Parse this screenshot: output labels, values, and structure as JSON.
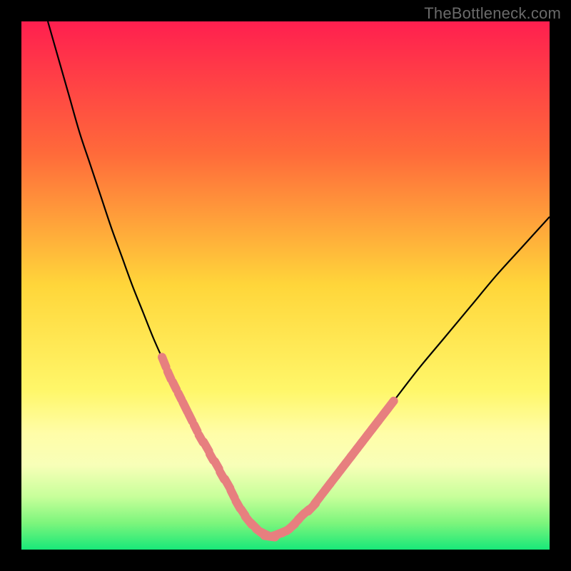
{
  "watermark": "TheBottleneck.com",
  "colors": {
    "frame": "#000000",
    "curve": "#000000",
    "overlay": "#e77f7f",
    "watermark": "#6a6a6a"
  },
  "chart_data": {
    "type": "line",
    "title": "",
    "xlabel": "",
    "ylabel": "",
    "xlim": [
      0,
      100
    ],
    "ylim": [
      0,
      100
    ],
    "background_gradient": [
      {
        "pos": 0.0,
        "color": "#ff1f4f"
      },
      {
        "pos": 0.25,
        "color": "#ff6a3a"
      },
      {
        "pos": 0.5,
        "color": "#ffd63a"
      },
      {
        "pos": 0.7,
        "color": "#fff76a"
      },
      {
        "pos": 0.78,
        "color": "#fffda8"
      },
      {
        "pos": 0.84,
        "color": "#f8ffb8"
      },
      {
        "pos": 0.9,
        "color": "#c7ff9a"
      },
      {
        "pos": 0.95,
        "color": "#7cf57c"
      },
      {
        "pos": 1.0,
        "color": "#18e879"
      }
    ],
    "series": [
      {
        "name": "bottleneck-curve",
        "x": [
          5,
          7,
          9,
          11,
          13,
          15,
          17,
          19,
          21,
          23,
          25,
          27,
          29,
          31,
          33,
          35,
          37,
          39,
          40,
          41,
          43,
          45,
          47,
          50,
          55,
          60,
          65,
          70,
          75,
          80,
          85,
          90,
          95,
          100
        ],
        "y": [
          100,
          93,
          86,
          79,
          73,
          67,
          61,
          55.5,
          50,
          45,
          40,
          35.5,
          31,
          27,
          23,
          19.5,
          16,
          12.5,
          10.5,
          8.5,
          5.5,
          3.5,
          2.5,
          3.5,
          8,
          14.5,
          21,
          27.5,
          34,
          40,
          46,
          52,
          57.5,
          63
        ]
      }
    ],
    "overlay_segments": {
      "name": "marker-dashes",
      "note": "Salmon dotted/segmented overlay along lower portion of curve",
      "points": [
        {
          "x": 27,
          "y": 35.5
        },
        {
          "x": 28,
          "y": 33
        },
        {
          "x": 29,
          "y": 31
        },
        {
          "x": 30,
          "y": 29
        },
        {
          "x": 31,
          "y": 27
        },
        {
          "x": 32,
          "y": 25
        },
        {
          "x": 33,
          "y": 23
        },
        {
          "x": 34,
          "y": 21
        },
        {
          "x": 35,
          "y": 19.5
        },
        {
          "x": 36,
          "y": 17.5
        },
        {
          "x": 37,
          "y": 16
        },
        {
          "x": 38,
          "y": 14
        },
        {
          "x": 39,
          "y": 12.5
        },
        {
          "x": 40,
          "y": 10.5
        },
        {
          "x": 41,
          "y": 8.5
        },
        {
          "x": 42,
          "y": 7
        },
        {
          "x": 43,
          "y": 5.5
        },
        {
          "x": 44,
          "y": 4.5
        },
        {
          "x": 45,
          "y": 3.5
        },
        {
          "x": 46,
          "y": 3
        },
        {
          "x": 47,
          "y": 2.5
        },
        {
          "x": 48,
          "y": 2.7
        },
        {
          "x": 49,
          "y": 3.1
        },
        {
          "x": 50,
          "y": 3.5
        },
        {
          "x": 51,
          "y": 4.2
        },
        {
          "x": 52,
          "y": 5.2
        },
        {
          "x": 53,
          "y": 6.3
        },
        {
          "x": 54,
          "y": 7.2
        },
        {
          "x": 55,
          "y": 8
        },
        {
          "x": 56,
          "y": 9.3
        },
        {
          "x": 57,
          "y": 10.6
        },
        {
          "x": 58,
          "y": 11.9
        },
        {
          "x": 59,
          "y": 13.2
        },
        {
          "x": 60,
          "y": 14.5
        },
        {
          "x": 61,
          "y": 15.8
        },
        {
          "x": 62,
          "y": 17.1
        },
        {
          "x": 63,
          "y": 18.4
        },
        {
          "x": 64,
          "y": 19.7
        },
        {
          "x": 65,
          "y": 21
        },
        {
          "x": 66,
          "y": 22.3
        },
        {
          "x": 67,
          "y": 23.6
        },
        {
          "x": 68,
          "y": 24.9
        },
        {
          "x": 69,
          "y": 26.2
        },
        {
          "x": 70,
          "y": 27.5
        }
      ]
    }
  }
}
